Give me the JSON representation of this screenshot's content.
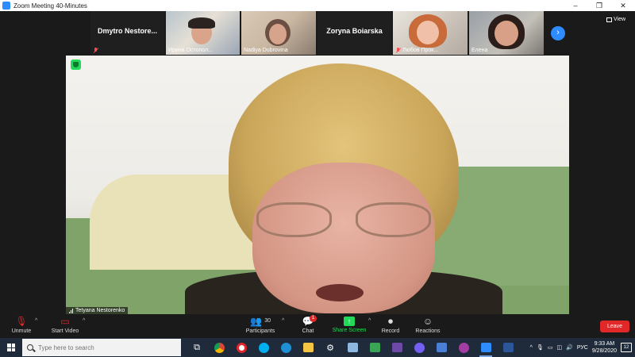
{
  "window": {
    "title": "Zoom Meeting 40-Minutes",
    "controls": [
      "–",
      "❐",
      "✕"
    ]
  },
  "thumbnails": [
    {
      "name": "Dmytro  Nestore...",
      "muted": true,
      "video": false
    },
    {
      "name": "Ирина Остопол...",
      "muted": false,
      "video": true
    },
    {
      "name": "Nadiya Dubrovina",
      "muted": false,
      "video": true
    },
    {
      "name": "Zoryna Boiarska",
      "muted": false,
      "video": false
    },
    {
      "name": "Любов Прок...",
      "muted": true,
      "video": true
    },
    {
      "name": "Елена",
      "muted": false,
      "video": true
    }
  ],
  "strip": {
    "next_glyph": "›",
    "view_label": "View"
  },
  "main_video": {
    "speaker_name": "Tetyana Nestorenko"
  },
  "toolbar": {
    "unmute_label": "Unmute",
    "start_video_label": "Start Video",
    "participants_label": "Participants",
    "participants_count": "30",
    "chat_label": "Chat",
    "chat_badge": "1",
    "share_label": "Share Screen",
    "record_label": "Record",
    "reactions_label": "Reactions",
    "leave_label": "Leave",
    "caret": "^"
  },
  "taskbar": {
    "search_placeholder": "Type here to search",
    "language": "РУС",
    "time": "9:33 AM",
    "date": "9/28/2020",
    "notifications": "12"
  },
  "colors": {
    "accent": "#2d8cff",
    "leave": "#e02828",
    "share": "#23d959"
  }
}
